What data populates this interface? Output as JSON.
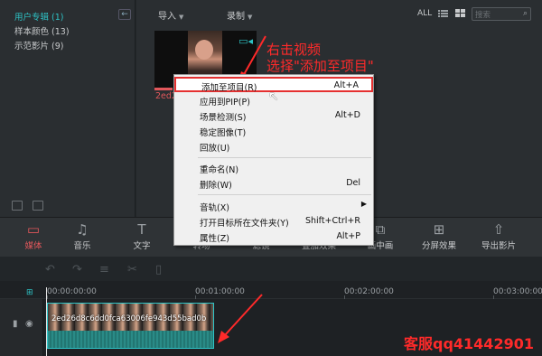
{
  "library": {
    "folders": [
      {
        "label": "用户专辑 (1)",
        "active": true
      },
      {
        "label": "样本颜色 (13)",
        "active": false
      },
      {
        "label": "示范影片 (9)",
        "active": false
      }
    ],
    "back_glyph": "←",
    "import_label": "导入",
    "record_label": "录制",
    "all_label": "ALL",
    "search_placeholder": "搜索",
    "clip_thumb_name": "2ed2"
  },
  "annotation": {
    "line1": "右击视频",
    "line2": "选择\"添加至项目\""
  },
  "context_menu": {
    "items": [
      {
        "label": "添加至项目(R)",
        "shortcut": "Alt+A"
      },
      {
        "label": "应用到PIP(P)",
        "shortcut": ""
      },
      {
        "label": "场景检测(S)",
        "shortcut": "Alt+D"
      },
      {
        "label": "稳定图像(T)",
        "shortcut": ""
      },
      {
        "label": "回放(U)",
        "shortcut": ""
      },
      {
        "label": "重命名(N)",
        "shortcut": ""
      },
      {
        "label": "删除(W)",
        "shortcut": "Del"
      },
      {
        "label": "音轨(X)",
        "shortcut": ""
      },
      {
        "label": "打开目标所在文件夹(Y)",
        "shortcut": "Shift+Ctrl+R"
      },
      {
        "label": "属性(Z)",
        "shortcut": "Alt+P"
      }
    ]
  },
  "toolbar": {
    "items": [
      {
        "label": "媒体",
        "icon": "folder-icon"
      },
      {
        "label": "音乐",
        "icon": "music-icon"
      },
      {
        "label": "文字",
        "icon": "text-icon"
      },
      {
        "label": "转场",
        "icon": "transition-icon"
      },
      {
        "label": "滤镜",
        "icon": "filter-icon"
      },
      {
        "label": "叠加效果",
        "icon": "overlay-icon"
      },
      {
        "label": "画中画",
        "icon": "pip-icon"
      },
      {
        "label": "分屏效果",
        "icon": "split-screen-icon"
      },
      {
        "label": "导出影片",
        "icon": "export-icon"
      }
    ]
  },
  "timeline": {
    "timecodes": [
      "00:00:00:00",
      "00:01:00:00",
      "00:02:00:00",
      "00:03:00:00"
    ],
    "clip_name": "2ed26d8c6dd0fca63006fe943d55bad0b"
  },
  "watermark": "客服qq41442901",
  "colors": {
    "accent": "#2ec4c7",
    "active_red": "#e2575b",
    "annotation_red": "#ff2a2a"
  }
}
